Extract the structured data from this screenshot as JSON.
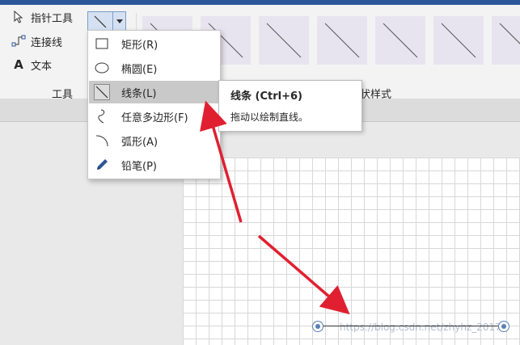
{
  "tools": {
    "pointer_label": "指针工具",
    "connector_label": "连接线",
    "text_label": "文本",
    "text_glyph": "A",
    "group_label": "工具"
  },
  "shape_styles_label_fragment": "状样式",
  "shape_menu": {
    "items": [
      {
        "label": "矩形(R)",
        "icon": "rectangle-icon"
      },
      {
        "label": "椭圆(E)",
        "icon": "ellipse-icon"
      },
      {
        "label": "线条(L)",
        "icon": "line-icon",
        "active": true
      },
      {
        "label": "任意多边形(F)",
        "icon": "freeform-icon"
      },
      {
        "label": "弧形(A)",
        "icon": "arc-icon"
      },
      {
        "label": "铅笔(P)",
        "icon": "pencil-icon"
      }
    ]
  },
  "tooltip": {
    "title": "线条 (Ctrl+6)",
    "description": "拖动以绘制直线。"
  },
  "watermark": "https://blog.csdn.net/zhyhz_2017",
  "colors": {
    "accent": "#2b579a",
    "annotation_arrow": "#e02030",
    "handle": "#5a7fb5"
  }
}
